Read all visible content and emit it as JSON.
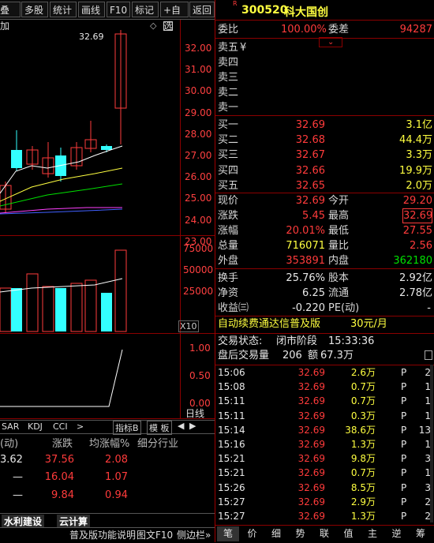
{
  "toolbar": {
    "items": [
      "叠加",
      "多股",
      "统计",
      "画线",
      "F10",
      "标记",
      "+自选",
      "返回"
    ]
  },
  "stock": {
    "marker": "R",
    "code": "300520",
    "name": "科大国创"
  },
  "order_ratio": {
    "label": "委比",
    "value": "100.00%",
    "diff_label": "委差",
    "diff_value": "94287"
  },
  "sell_levels": [
    {
      "label": "卖五",
      "price": "",
      "vol": "",
      "extra": "¥"
    },
    {
      "label": "卖四",
      "price": "",
      "vol": ""
    },
    {
      "label": "卖三",
      "price": "",
      "vol": ""
    },
    {
      "label": "卖二",
      "price": "",
      "vol": ""
    },
    {
      "label": "卖一",
      "price": "",
      "vol": ""
    }
  ],
  "buy_levels": [
    {
      "label": "买一",
      "price": "32.69",
      "vol": "3.1亿"
    },
    {
      "label": "买二",
      "price": "32.68",
      "vol": "44.4万"
    },
    {
      "label": "买三",
      "price": "32.67",
      "vol": "3.3万"
    },
    {
      "label": "买四",
      "price": "32.66",
      "vol": "19.9万"
    },
    {
      "label": "买五",
      "price": "32.65",
      "vol": "2.0万"
    }
  ],
  "quote": {
    "xianjia_l": "现价",
    "xianjia": "32.69",
    "jinkai_l": "今开",
    "jinkai": "29.20",
    "zhangdie_l": "涨跌",
    "zhangdie": "5.45",
    "zuigao_l": "最高",
    "zuigao": "32.69",
    "zhangfu_l": "涨幅",
    "zhangfu": "20.01%",
    "zuidi_l": "最低",
    "zuidi": "27.55",
    "zongliang_l": "总量",
    "zongliang": "716071",
    "liangbi_l": "量比",
    "liangbi": "2.56",
    "waipan_l": "外盘",
    "waipan": "353891",
    "neipan_l": "内盘",
    "neipan": "362180"
  },
  "fundamentals": {
    "huanshou_l": "换手",
    "huanshou": "25.76%",
    "guben_l": "股本",
    "guben": "2.92亿",
    "jingzi_l": "净资",
    "jingzi": "6.25",
    "liutong_l": "流通",
    "liutong": "2.78亿",
    "shouyi_l": "收益㈢",
    "shouyi": "-0.220",
    "pe_l": "PE(动)",
    "pe": "-"
  },
  "promo": {
    "text": "自动续费通达信普及版",
    "price": "30元/月"
  },
  "trade_status": {
    "label": "交易状态:",
    "value": "闭市阶段",
    "time": "15:33:36",
    "after_label": "盘后交易量",
    "after_vol": "206",
    "amount_label": "额",
    "amount": "67.3万"
  },
  "ticks": [
    {
      "time": "15:06",
      "price": "32.69",
      "vol": "2.6万",
      "flag": "P",
      "n": "2"
    },
    {
      "time": "15:08",
      "price": "32.69",
      "vol": "0.7万",
      "flag": "P",
      "n": "1"
    },
    {
      "time": "15:11",
      "price": "32.69",
      "vol": "0.7万",
      "flag": "P",
      "n": "1"
    },
    {
      "time": "15:11",
      "price": "32.69",
      "vol": "0.3万",
      "flag": "P",
      "n": "1"
    },
    {
      "time": "15:14",
      "price": "32.69",
      "vol": "38.6万",
      "flag": "P",
      "n": "13"
    },
    {
      "time": "15:16",
      "price": "32.69",
      "vol": "1.3万",
      "flag": "P",
      "n": "1"
    },
    {
      "time": "15:21",
      "price": "32.69",
      "vol": "9.8万",
      "flag": "P",
      "n": "3"
    },
    {
      "time": "15:21",
      "price": "32.69",
      "vol": "0.7万",
      "flag": "P",
      "n": "1"
    },
    {
      "time": "15:26",
      "price": "32.69",
      "vol": "8.5万",
      "flag": "P",
      "n": "3"
    },
    {
      "time": "15:27",
      "price": "32.69",
      "vol": "2.9万",
      "flag": "P",
      "n": "2"
    },
    {
      "time": "15:27",
      "price": "32.69",
      "vol": "1.3万",
      "flag": "P",
      "n": "2"
    }
  ],
  "bottom_tabs": [
    "笔",
    "价",
    "细",
    "势",
    "联",
    "值",
    "主",
    "逆",
    "筹"
  ],
  "chart": {
    "price_axis": [
      "32.00",
      "31.00",
      "30.00",
      "29.00",
      "28.00",
      "27.00",
      "26.00",
      "25.00",
      "24.00",
      "23.00"
    ],
    "high_label": "32.69",
    "vol_axis": [
      "75000",
      "50000",
      "25000"
    ],
    "vol_unit": "X10",
    "ind_axis": [
      "1.00",
      "0.50",
      "0.00"
    ],
    "period_label": "日线",
    "indicator_tabs": [
      "SAR",
      "KDJ",
      "CCI"
    ],
    "tab_arrow": ">",
    "indicator_btn": "指标B",
    "template_btn": "模 板"
  },
  "sector_table": {
    "headers": [
      "(动)",
      "涨跌",
      "均涨幅%",
      "细分行业"
    ],
    "rows": [
      {
        "c0": "3.62",
        "c1": "37.56",
        "c2": "2.08"
      },
      {
        "c0": "—",
        "c1": "16.04",
        "c2": "1.07"
      },
      {
        "c0": "—",
        "c1": "9.84",
        "c2": "0.94"
      }
    ],
    "tabs": [
      "水利建设",
      "云计算"
    ]
  },
  "status_bar": {
    "text": "普及版功能说明",
    "f10": "图文F10",
    "sidebar": "侧边栏»"
  },
  "colors": {
    "up": "#ff3b3b",
    "down": "#33ffff",
    "border": "#8b0000",
    "bg": "#000000"
  }
}
